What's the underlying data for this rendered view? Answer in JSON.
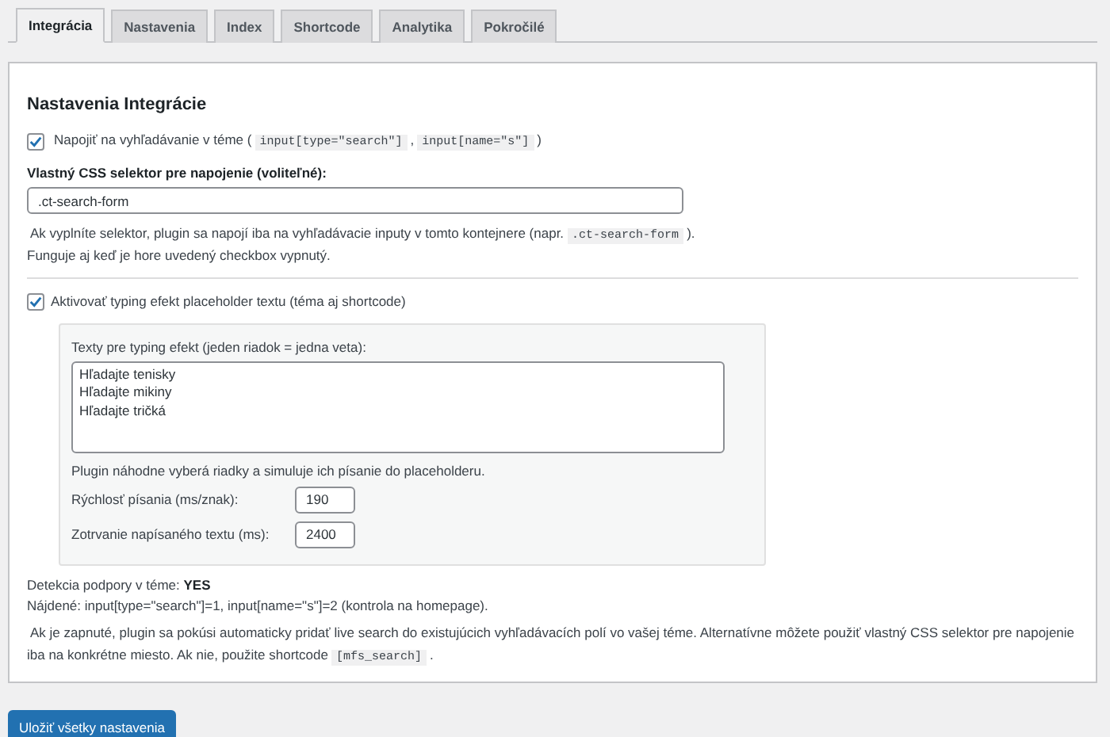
{
  "tabs": [
    {
      "label": "Integrácia",
      "selected": true
    },
    {
      "label": "Nastavenia",
      "selected": false
    },
    {
      "label": "Index",
      "selected": false
    },
    {
      "label": "Shortcode",
      "selected": false
    },
    {
      "label": "Analytika",
      "selected": false
    },
    {
      "label": "Pokročilé",
      "selected": false
    }
  ],
  "section_title": "Nastavenia Integrácie",
  "hook_checkbox": {
    "checked": true,
    "parts": [
      {
        "kind": "text",
        "text": "Napojiť na vyhľadávanie v téme ("
      },
      {
        "kind": "code",
        "text": "input[type=\"search\"]"
      },
      {
        "kind": "text",
        "text": ","
      },
      {
        "kind": "code",
        "text": "input[name=\"s\"]"
      },
      {
        "kind": "text",
        "text": ")"
      }
    ]
  },
  "selector_field": {
    "label": "Vlastný CSS selektor pre napojenie (voliteľné):",
    "value": ".ct-search-form"
  },
  "selector_help": [
    {
      "kind": "text",
      "text": "Ak vyplníte selektor, plugin sa napojí iba na vyhľadávacie inputy v tomto kontejnere (napr."
    },
    {
      "kind": "code",
      "text": ".ct-search-form"
    },
    {
      "kind": "text",
      "text": "). Funguje aj keď je hore uvedený checkbox vypnutý."
    }
  ],
  "typing_checkbox": {
    "checked": true,
    "label": "Aktivovať typing efekt placeholder textu (téma aj shortcode)"
  },
  "typing_panel": {
    "texts_label": "Texty pre typing efekt (jeden riadok = jedna veta):",
    "texts_lines": [
      "Hľadajte tenisky",
      "Hľadajte mikiny",
      "Hľadajte tričká"
    ],
    "help": "Plugin náhodne vyberá riadky a simuluje ich písanie do placeholderu.",
    "fields": [
      {
        "label": "Rýchlosť písania (ms/znak):",
        "value": "190"
      },
      {
        "label": "Zotrvanie napísaného textu (ms):",
        "value": "2400"
      }
    ]
  },
  "detection": {
    "label": "Detekcia podpory v téme:",
    "value": "YES"
  },
  "found": "Nájdené: input[type=\"search\"]=1, input[name=\"s\"]=2 (kontrola na homepage).",
  "info": [
    {
      "kind": "text",
      "text": "Ak je zapnuté, plugin sa pokúsi automaticky pridať live search do existujúcich vyhľadávacích polí vo vašej téme. Alternatívne môžete použiť vlastný CSS selektor pre napojenie iba na konkrétne miesto. Ak nie, použite shortcode"
    },
    {
      "kind": "code",
      "text": "[mfs_search]"
    },
    {
      "kind": "text",
      "text": "."
    }
  ],
  "save_button": "Uložiť všetky nastavenia"
}
